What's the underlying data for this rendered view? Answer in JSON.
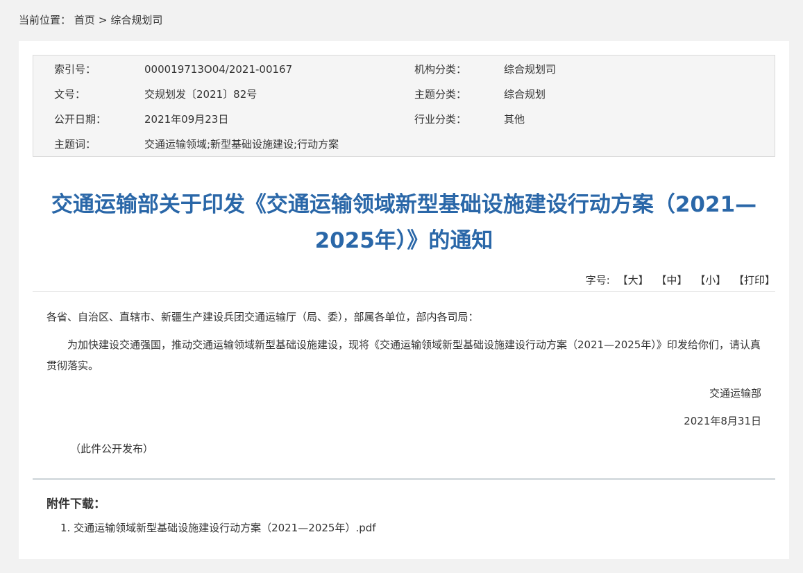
{
  "breadcrumb": {
    "label": "当前位置：",
    "home": "首页",
    "separator": ">",
    "current": "综合规划司"
  },
  "meta": {
    "index_label": "索引号：",
    "index_value": "000019713O04/2021-00167",
    "org_label": "机构分类：",
    "org_value": "综合规划司",
    "doc_label": "文号：",
    "doc_value": "交规划发〔2021〕82号",
    "topic_label": "主题分类：",
    "topic_value": "综合规划",
    "date_label": "公开日期：",
    "date_value": "2021年09月23日",
    "industry_label": "行业分类：",
    "industry_value": "其他",
    "keywords_label": "主题词：",
    "keywords_value": "交通运输领域;新型基础设施建设;行动方案"
  },
  "article": {
    "title_line1": "交通运输部关于印发《交通运输领域新型基础设施建设行动方案（2021—",
    "title_line2": "2025年）》的通知",
    "font_size_label": "字号:",
    "font_large": "【大】",
    "font_medium": "【中】",
    "font_small": "【小】",
    "print": "【打印】",
    "salutation": "各省、自治区、直辖市、新疆生产建设兵团交通运输厅（局、委），部属各单位，部内各司局：",
    "paragraph": "为加快建设交通强国，推动交通运输领域新型基础设施建设，现将《交通运输领域新型基础设施建设行动方案（2021—2025年）》印发给你们，请认真贯彻落实。",
    "signature_org": "交通运输部",
    "signature_date": "2021年8月31日",
    "publish_note": "（此件公开发布）"
  },
  "attachments": {
    "heading": "附件下载：",
    "items": [
      {
        "number": "1.",
        "name": "交通运输领域新型基础设施建设行动方案（2021—2025年）.pdf"
      }
    ]
  },
  "colors": {
    "page_background": "#f2f2f2",
    "title": "#2a67a8",
    "meta_background": "#f5f5f5"
  }
}
